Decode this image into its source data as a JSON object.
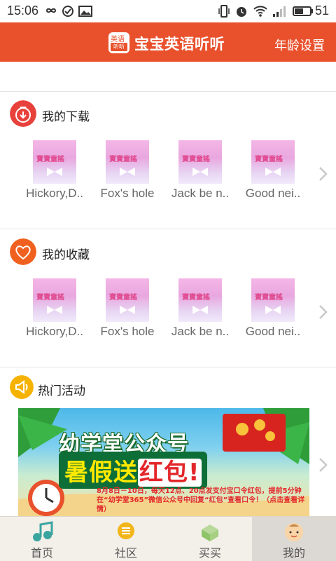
{
  "status_bar": {
    "time": "15:06",
    "battery": "51"
  },
  "header": {
    "logo_top": "英语",
    "logo_bottom": "听听",
    "title": "宝宝英语听听",
    "age_setting": "年龄设置"
  },
  "downloads": {
    "title": "我的下载",
    "items": [
      {
        "caption": "Hickory,D..",
        "thumb_text": "寶寶童謠"
      },
      {
        "caption": "Fox's hole",
        "thumb_text": "寶寶童謠"
      },
      {
        "caption": "Jack be n..",
        "thumb_text": "寶寶童謠"
      },
      {
        "caption": "Good nei..",
        "thumb_text": "寶寶童謠"
      }
    ]
  },
  "favorites": {
    "title": "我的收藏",
    "items": [
      {
        "caption": "Hickory,D..",
        "thumb_text": "寶寶童謠"
      },
      {
        "caption": "Fox's hole",
        "thumb_text": "寶寶童謠"
      },
      {
        "caption": "Jack be n..",
        "thumb_text": "寶寶童謠"
      },
      {
        "caption": "Good nei..",
        "thumb_text": "寶寶童謠"
      }
    ]
  },
  "activities": {
    "title": "热门活动",
    "banner_line1": "幼学堂公众号",
    "banner_line2a": "暑假送",
    "banner_line2b": "红包!",
    "banner_desc": "8月8日－10日，每天12点、20点发支付宝口令红包，提前5分钟在“幼学堂365”微信公众号中回复“红包”查看口令！（点击查看详情）"
  },
  "tabs": [
    {
      "label": "首页",
      "icon": "music-note-icon"
    },
    {
      "label": "社区",
      "icon": "community-icon"
    },
    {
      "label": "买买",
      "icon": "shopping-icon"
    },
    {
      "label": "我的",
      "icon": "baby-face-icon",
      "active": true
    }
  ],
  "colors": {
    "accent": "#e9512d",
    "download_icon": "#e8413c",
    "favorite_icon": "#f0601f",
    "activity_icon": "#f5b300"
  }
}
